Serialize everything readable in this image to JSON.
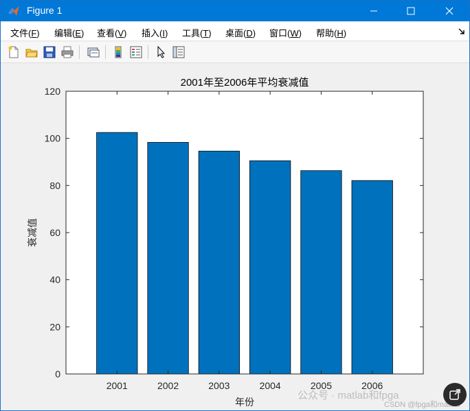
{
  "window": {
    "title": "Figure 1"
  },
  "menu": [
    {
      "label": "文件(",
      "key": "F",
      "tail": ")"
    },
    {
      "label": "编辑(",
      "key": "E",
      "tail": ")"
    },
    {
      "label": "查看(",
      "key": "V",
      "tail": ")"
    },
    {
      "label": "插入(",
      "key": "I",
      "tail": ")"
    },
    {
      "label": "工具(",
      "key": "T",
      "tail": ")"
    },
    {
      "label": "桌面(",
      "key": "D",
      "tail": ")"
    },
    {
      "label": "窗口(",
      "key": "W",
      "tail": ")"
    },
    {
      "label": "帮助(",
      "key": "H",
      "tail": ")"
    }
  ],
  "chart_data": {
    "type": "bar",
    "title": "2001年至2006年平均衰减值",
    "xlabel": "年份",
    "ylabel": "衰减值",
    "categories": [
      "2001",
      "2002",
      "2003",
      "2004",
      "2005",
      "2006"
    ],
    "values": [
      102.5,
      98.3,
      94.6,
      90.5,
      86.3,
      82.1
    ],
    "ylim": [
      0,
      120
    ],
    "yticks": [
      0,
      20,
      40,
      60,
      80,
      100,
      120
    ],
    "xlim": [
      2000,
      2007
    ],
    "bar_color": "#0072bd",
    "grid": false
  },
  "watermark": {
    "line1": "公众号 · matlab和fpga",
    "line2": "CSDN @fpga和matlab"
  },
  "colors": {
    "titlebar": "#0078d7",
    "bar": "#0072bd"
  }
}
